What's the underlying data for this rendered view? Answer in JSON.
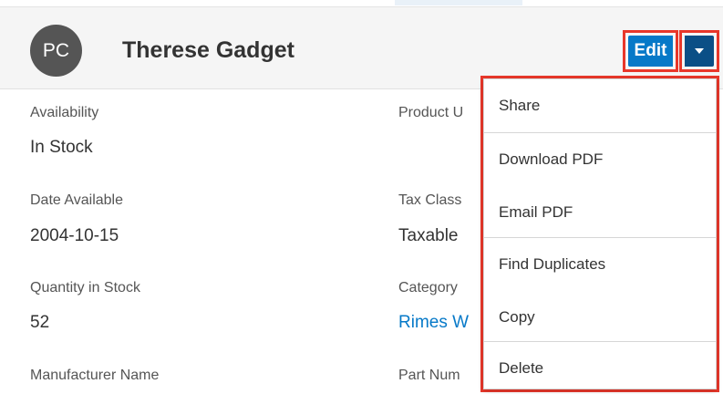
{
  "record": {
    "initials": "PC",
    "name": "Therese Gadget"
  },
  "actions": {
    "edit_label": "Edit"
  },
  "fields": [
    {
      "label": "Availability",
      "value": "In Stock"
    },
    {
      "label": "Date Available",
      "value": "2004-10-15"
    },
    {
      "label": "Quantity in Stock",
      "value": "52"
    },
    {
      "label": "Manufacturer Name",
      "value": ""
    }
  ],
  "fields_right": [
    {
      "label": "Product U",
      "value": ""
    },
    {
      "label": "Tax Class",
      "value": "Taxable"
    },
    {
      "label": "Category",
      "value": "Rimes W"
    },
    {
      "label": "Part Num",
      "value": ""
    }
  ],
  "menu": {
    "items": [
      "Share",
      "Download PDF",
      "Email PDF",
      "Find Duplicates",
      "Copy",
      "Delete"
    ]
  },
  "colors": {
    "primary": "#0679c8",
    "primary_dark": "#0b4f86",
    "highlight": "#e8372a",
    "avatar": "#555555"
  }
}
